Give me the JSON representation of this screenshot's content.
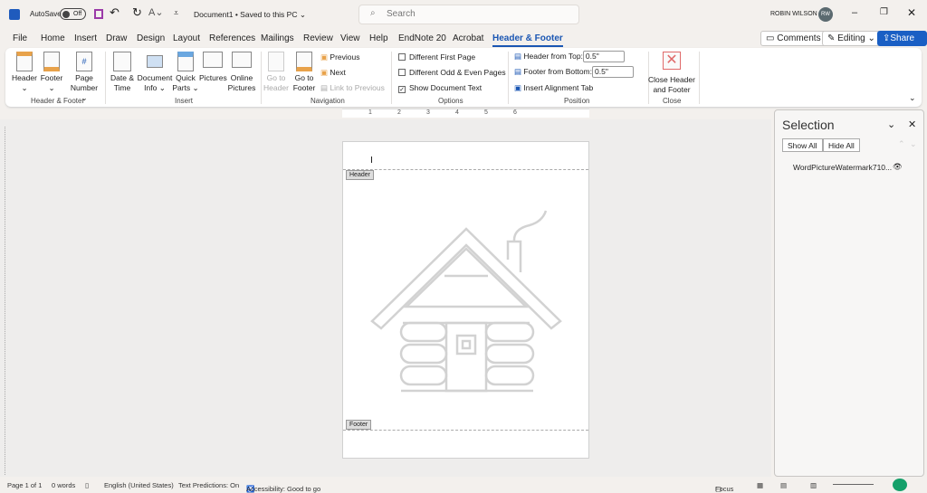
{
  "titlebar": {
    "autosave_label": "AutoSave",
    "autosave_state": "Off",
    "doc_title": "Document1 • Saved to this PC ⌄",
    "search_placeholder": "Search",
    "user_name": "ROBIN WILSON",
    "user_initials": "RW"
  },
  "tabs": [
    "File",
    "Home",
    "Insert",
    "Draw",
    "Design",
    "Layout",
    "References",
    "Mailings",
    "Review",
    "View",
    "Help",
    "EndNote 20",
    "Acrobat",
    "Header & Footer"
  ],
  "top_buttons": {
    "comments": "Comments",
    "editing": "Editing ⌄",
    "share": "Share ⌄"
  },
  "ribbon": {
    "hf": {
      "header": "Header",
      "footer": "Footer",
      "page": "Page",
      "number": "Number ⌄",
      "group": "Header & Footer"
    },
    "insert": {
      "date1": "Date &",
      "date2": "Time",
      "doc1": "Document",
      "doc2": "Info ⌄",
      "qp1": "Quick",
      "qp2": "Parts ⌄",
      "pictures": "Pictures",
      "op1": "Online",
      "op2": "Pictures",
      "group": "Insert"
    },
    "nav": {
      "gth1": "Go to",
      "gth2": "Header",
      "gtf1": "Go to",
      "gtf2": "Footer",
      "previous": "Previous",
      "next": "Next",
      "link": "Link to Previous",
      "group": "Navigation"
    },
    "options": {
      "diff_first": "Different First Page",
      "diff_odd": "Different Odd & Even Pages",
      "show_doc": "Show Document Text",
      "group": "Options"
    },
    "position": {
      "header_top": "Header from Top:",
      "header_top_val": "0.5\"",
      "footer_bottom": "Footer from Bottom:",
      "footer_bottom_val": "0.5\"",
      "align_tab": "Insert Alignment Tab",
      "group": "Position"
    },
    "close": {
      "l1": "Close Header",
      "l2": "and Footer",
      "group": "Close"
    }
  },
  "ruler": [
    "1",
    "2",
    "3",
    "4",
    "5",
    "6"
  ],
  "page": {
    "header_tag": "Header",
    "footer_tag": "Footer"
  },
  "selection_pane": {
    "title": "Selection",
    "show_all": "Show All",
    "hide_all": "Hide All",
    "items": [
      "WordPictureWatermark710..."
    ]
  },
  "status": {
    "page": "Page 1 of 1",
    "words": "0 words",
    "language": "English (United States)",
    "predictions": "Text Predictions: On",
    "accessibility": "Accessibility: Good to go",
    "focus": "Focus"
  },
  "colors": {
    "accent": "#1a56b3",
    "share": "#1a5fc4"
  }
}
